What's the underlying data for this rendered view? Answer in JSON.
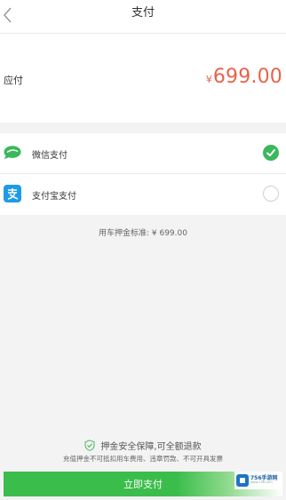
{
  "header": {
    "title": "支付",
    "back_icon": "chevron-left-icon"
  },
  "payable": {
    "label": "应付",
    "currency": "¥",
    "amount": "699.00"
  },
  "methods": [
    {
      "label": "微信支付",
      "icon": "wechat-icon",
      "selected": true,
      "color": "#3bb85c"
    },
    {
      "label": "支付宝支付",
      "icon": "alipay-icon",
      "selected": false,
      "color": "#1e9be8"
    }
  ],
  "deposit": {
    "text": "用车押金标准: ¥ 699.00"
  },
  "guarantee": {
    "title": "押金安全保障,可全额退款",
    "note": "充值押金不可抵扣用车费用、违章罚款、不可开具发票"
  },
  "pay_button": {
    "label": "立即支付",
    "color": "#3bbd4b"
  },
  "watermark": {
    "text": "756手游网",
    "sub": "www.756.com"
  }
}
